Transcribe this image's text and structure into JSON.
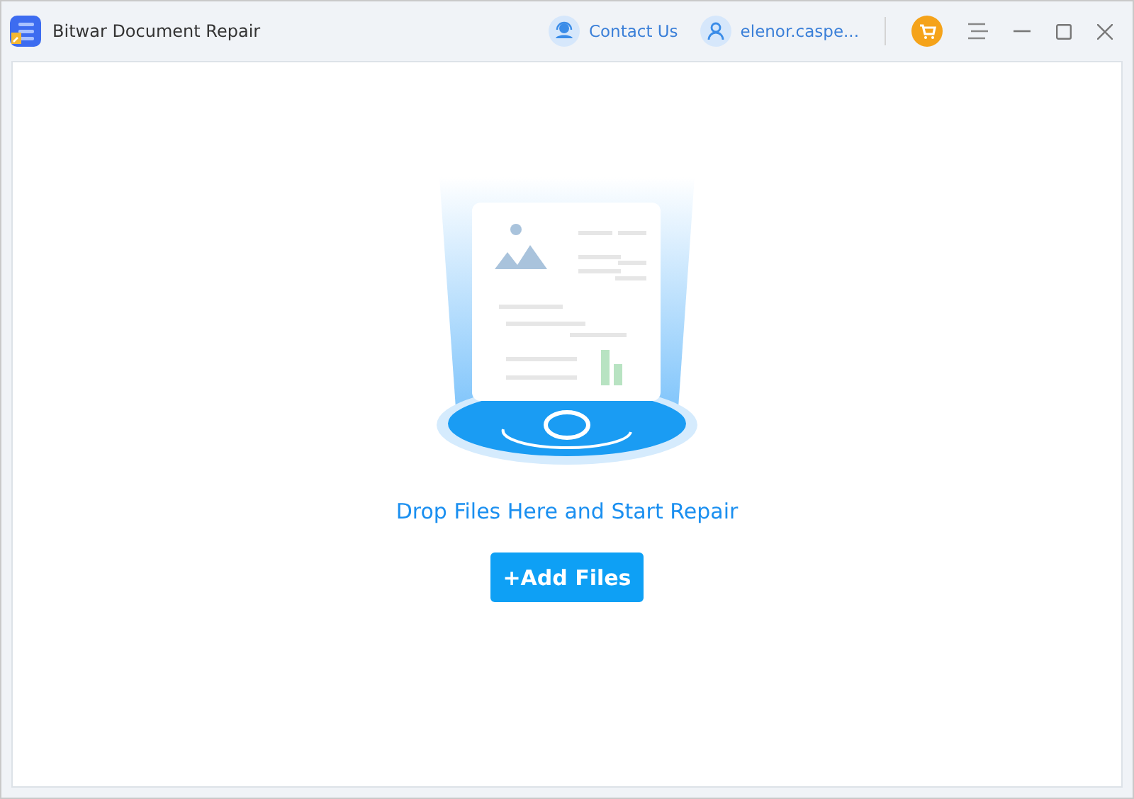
{
  "window": {
    "title": "Bitwar Document Repair"
  },
  "header": {
    "contact": "Contact Us",
    "account": "elenor.caspe..."
  },
  "dropzone": {
    "prompt": "Drop Files Here and Start Repair",
    "button": "+Add Files"
  }
}
